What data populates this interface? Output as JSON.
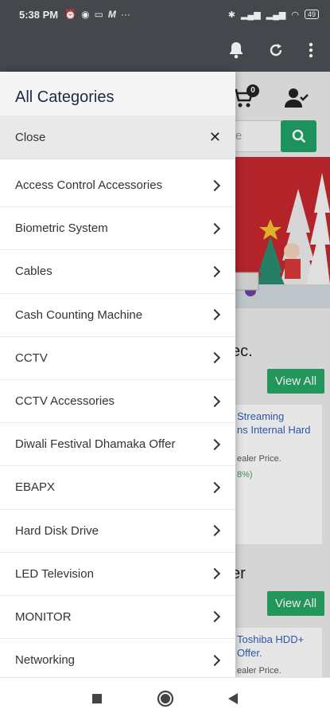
{
  "status_bar": {
    "time": "5:38 PM",
    "battery": "49"
  },
  "background": {
    "cart_count": "0",
    "search_placeholder": "re",
    "section1_title": "ec.",
    "view_all_label": "View All",
    "product1": {
      "title": "Streaming\nns Internal Hard",
      "dealer": "ealer Price.",
      "pct": "8%)"
    },
    "section2_title": "er",
    "product2": {
      "title": "Toshiba HDD+\nOffer.",
      "dealer": "ealer Price."
    }
  },
  "drawer": {
    "title": "All Categories",
    "close_label": "Close",
    "items": [
      {
        "label": "Access Control Accessories"
      },
      {
        "label": "Biometric System"
      },
      {
        "label": "Cables"
      },
      {
        "label": "Cash Counting Machine"
      },
      {
        "label": "CCTV"
      },
      {
        "label": "CCTV Accessories"
      },
      {
        "label": "Diwali Festival Dhamaka Offer"
      },
      {
        "label": "EBAPX"
      },
      {
        "label": "Hard Disk Drive"
      },
      {
        "label": "LED Television"
      },
      {
        "label": "MONITOR"
      },
      {
        "label": "Networking"
      }
    ]
  },
  "colors": {
    "toolbar": "#4a4f54",
    "accent_green": "#27a363",
    "banner_red": "#c2262e"
  }
}
